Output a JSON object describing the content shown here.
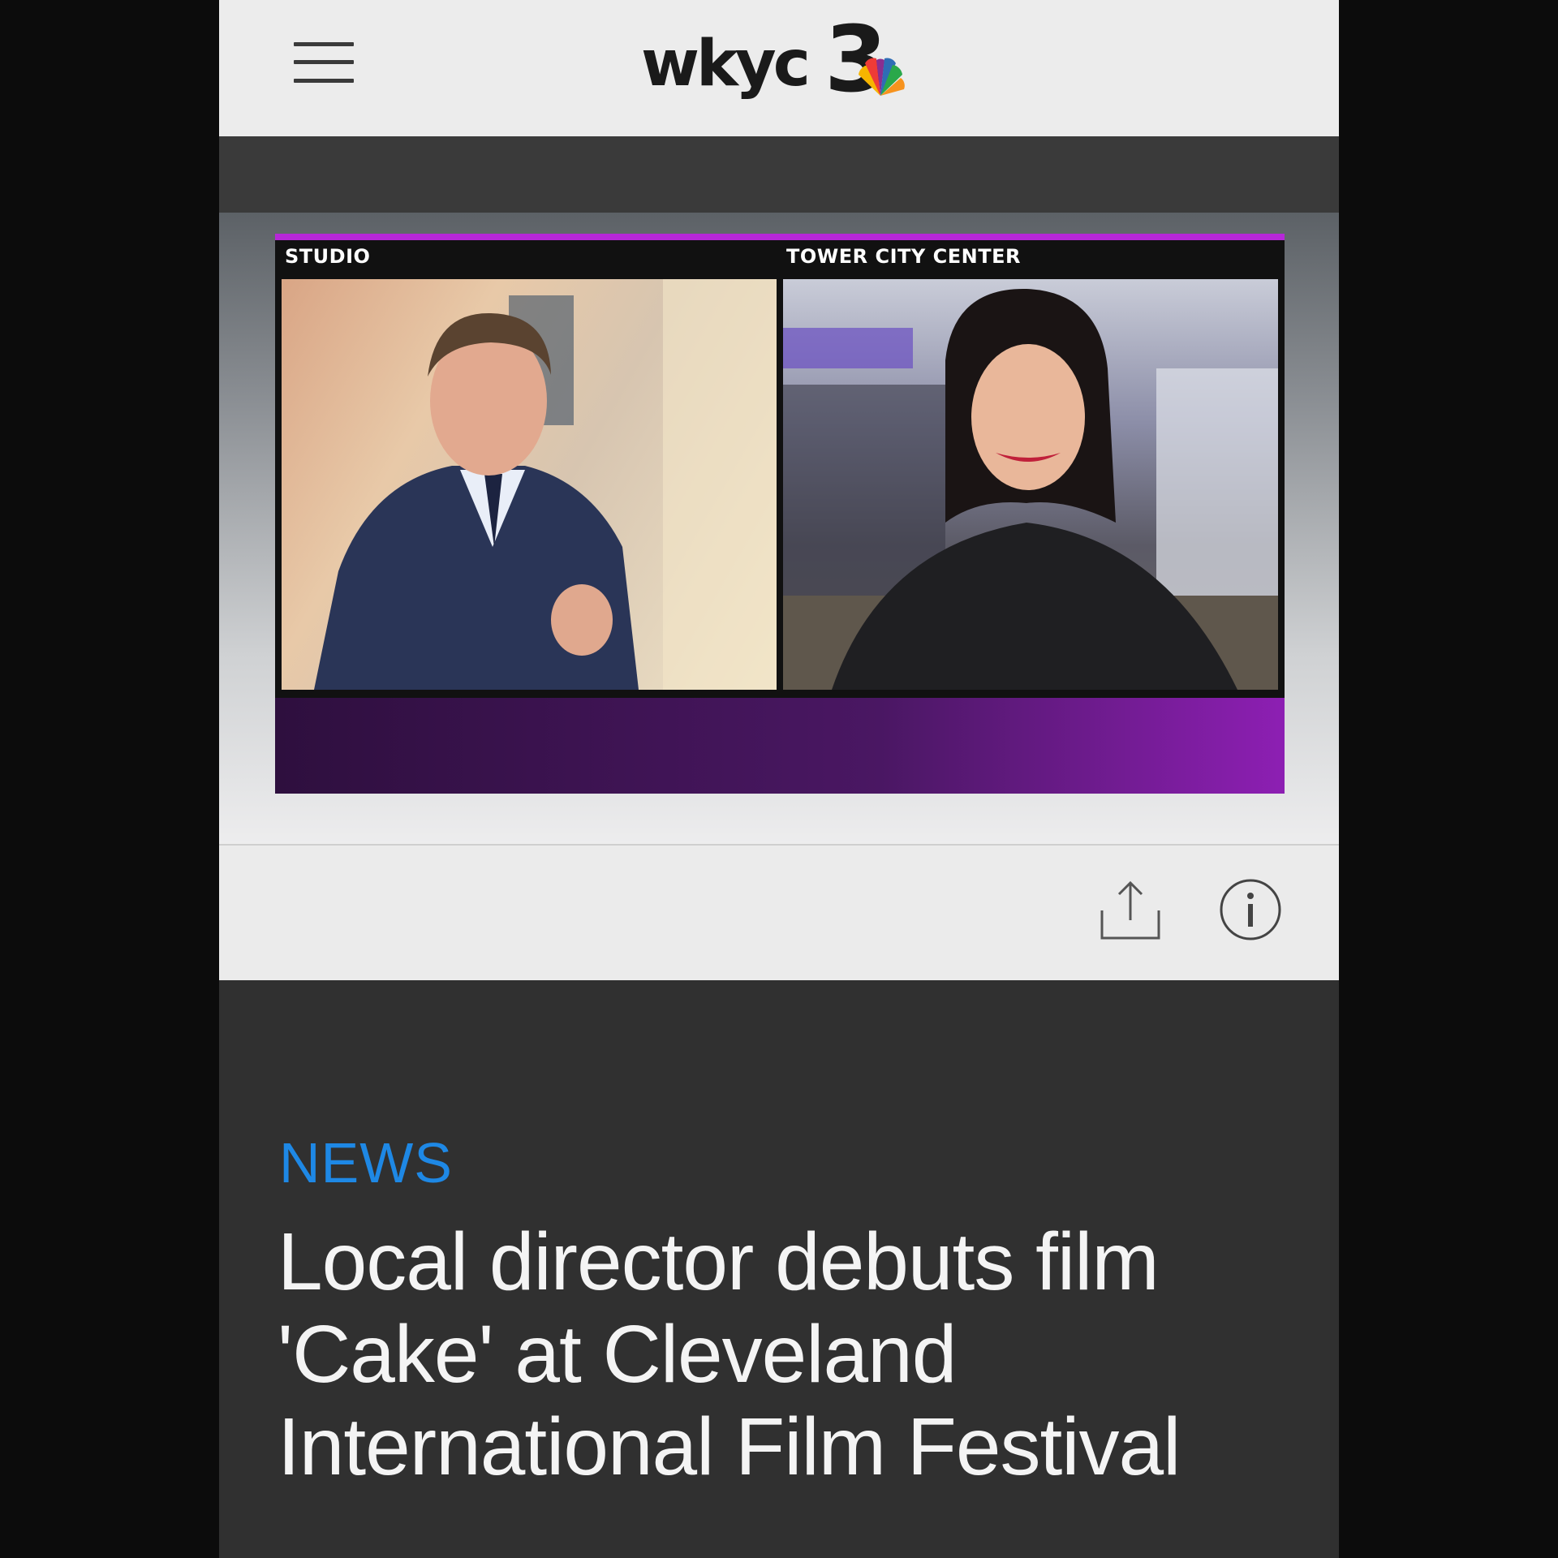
{
  "header": {
    "logo_text": "wkyc",
    "logo_number": "3",
    "menu_icon": "hamburger-menu-icon"
  },
  "video": {
    "left_label": "STUDIO",
    "right_label": "TOWER CITY CENTER",
    "accent_color": "#b727d8"
  },
  "toolbar": {
    "share_icon": "share-icon",
    "info_icon": "info-icon"
  },
  "article": {
    "category": "NEWS",
    "category_color": "#1e88e5",
    "headline": "Local director debuts film 'Cake' at Cleveland International Film Festival"
  }
}
